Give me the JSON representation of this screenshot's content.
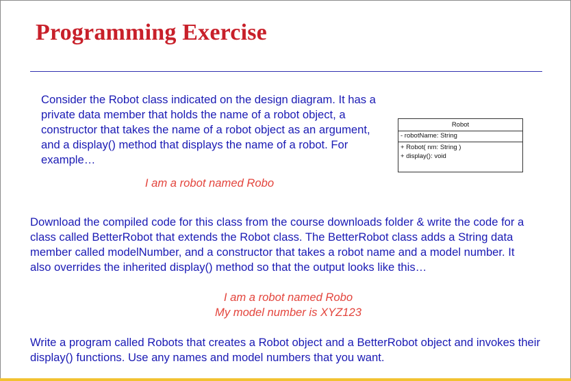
{
  "slide": {
    "title": "Programming Exercise",
    "paragraph1": "Consider the Robot class indicated on the design diagram. It has a private data member that holds the name of a robot object, a constructor that takes the name of a robot object as an argument, and a display() method that displays the name of a robot. For example…",
    "example1": "I am a robot named Robo",
    "paragraph2": "Download the compiled code for this class from the course downloads folder & write the code for a class called BetterRobot that extends the Robot class. The BetterRobot class adds a String data member called modelNumber, and a constructor that takes a robot name and a model number. It also overrides the inherited display() method so that the output looks like this…",
    "example2_line1": "I am a robot named Robo",
    "example2_line2": "My model number is XYZ123",
    "paragraph3": "Write a program called Robots that creates a Robot object and a BetterRobot object and invokes their display() functions. Use any names and model numbers that you want."
  },
  "uml": {
    "class_name": "Robot",
    "attributes": [
      "- robotName: String"
    ],
    "operations": [
      "+ Robot( nm: String )",
      "+ display(): void"
    ]
  },
  "colors": {
    "title": "#c8202a",
    "body_text": "#1a1ab4",
    "example_text": "#e3443c",
    "rule": "#2f2fb0",
    "bottom_bar": "#f2c230"
  }
}
